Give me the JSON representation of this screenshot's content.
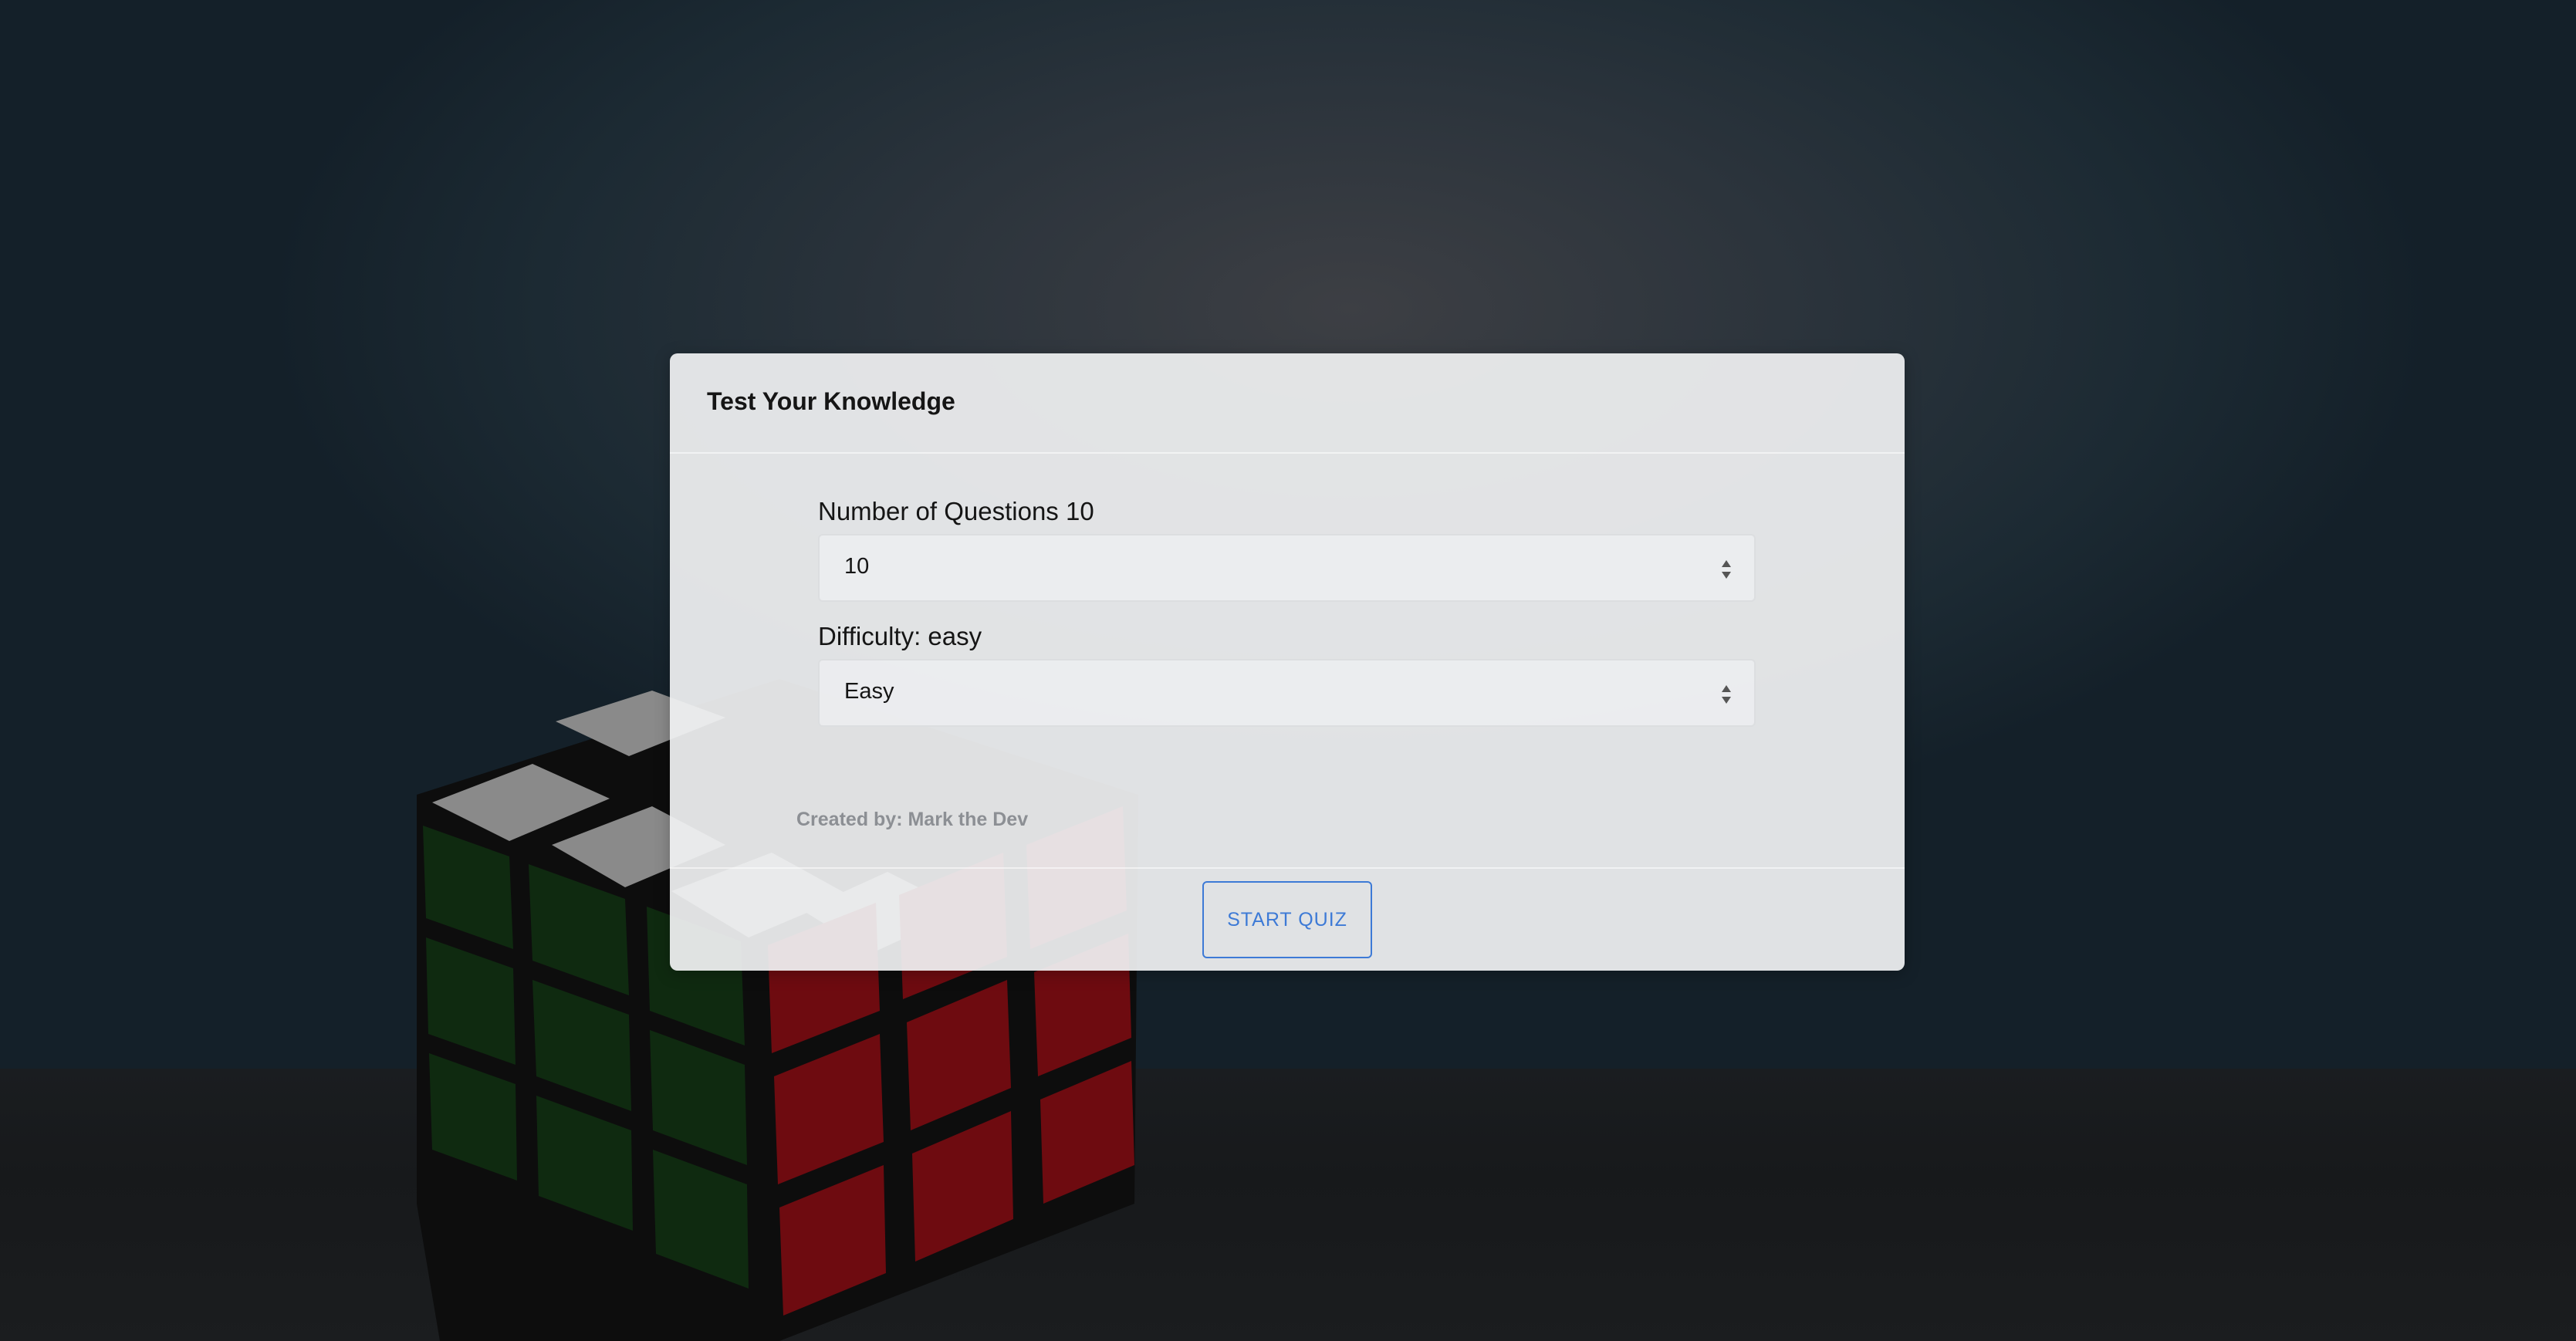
{
  "card": {
    "title": "Test Your Knowledge"
  },
  "questions": {
    "label": "Number of Questions 10",
    "selected": "10"
  },
  "difficulty": {
    "label": "Difficulty: easy",
    "selected": "Easy"
  },
  "footer": {
    "credit": "Created by: Mark the Dev",
    "start_label": "START QUIZ"
  },
  "colors": {
    "accent": "#3d7ad6",
    "card_bg": "#eeeff0",
    "background": "#1c2a33"
  },
  "icons": {
    "select_arrow": "up-down-caret-icon"
  }
}
